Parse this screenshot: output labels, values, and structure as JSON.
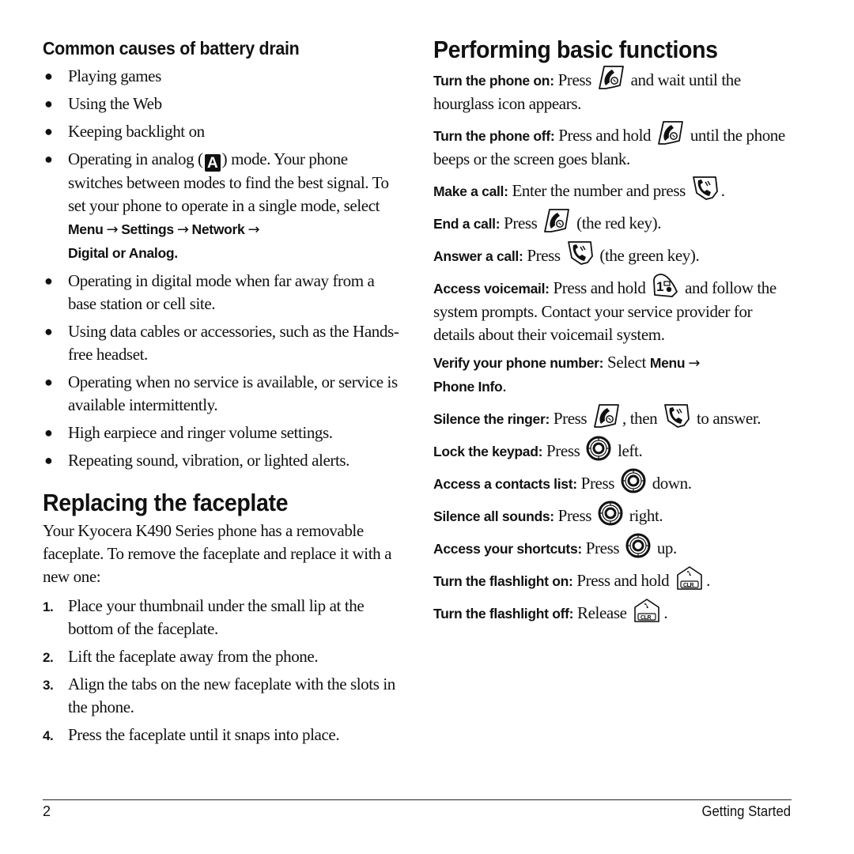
{
  "left_column": {
    "battery_section": {
      "heading": "Common causes of battery drain",
      "bullets": [
        {
          "text": "Playing games"
        },
        {
          "text": "Using the Web"
        },
        {
          "text": "Keeping backlight on"
        },
        {
          "text_before_icon": "Operating in analog (",
          "icon": "analog-mode-icon",
          "icon_glyph": "A",
          "text_after_icon": ") mode. Your phone switches between modes to find the best signal. To set your phone to operate in a single mode, select",
          "menu_path": [
            "Menu",
            "Settings",
            "Network",
            "Digital or Analog."
          ]
        },
        {
          "text": "Operating in digital mode when far away from a base station or cell site."
        },
        {
          "text": "Using data cables or accessories, such as the Hands-free headset."
        },
        {
          "text": "Operating when no service is available, or service is available intermittently."
        },
        {
          "text": "High earpiece and ringer volume settings."
        },
        {
          "text": "Repeating sound, vibration, or lighted alerts."
        }
      ]
    },
    "faceplate_section": {
      "heading": "Replacing the faceplate",
      "intro": "Your Kyocera K490 Series phone has a removable faceplate. To remove the faceplate and replace it with a new one:",
      "steps": [
        {
          "number": "1.",
          "text": "Place your thumbnail under the small lip at the bottom of the faceplate."
        },
        {
          "number": "2.",
          "text": "Lift the faceplate away from the phone."
        },
        {
          "number": "3.",
          "text": "Align the tabs on the new faceplate with the slots in the phone."
        },
        {
          "number": "4.",
          "text": "Press the faceplate until it snaps into place."
        }
      ]
    }
  },
  "right_column": {
    "heading": "Performing basic functions",
    "arrow_glyph": "→",
    "entries": [
      {
        "label": "Turn the phone on:",
        "before": " Press ",
        "icon": "end-power-key-icon",
        "after": " and wait until the hourglass icon appears."
      },
      {
        "label": "Turn the phone off:",
        "before": " Press and hold ",
        "icon": "end-power-key-icon",
        "after": " until the phone beeps or the screen goes blank."
      },
      {
        "label": "Make a call:",
        "before": " Enter the number and press ",
        "icon": "send-key-icon",
        "after": "."
      },
      {
        "label": "End a call:",
        "before": " Press ",
        "icon": "end-power-key-icon",
        "after": " (the red key)."
      },
      {
        "label": "Answer a call:",
        "before": " Press ",
        "icon": "send-key-icon",
        "after": " (the green key)."
      },
      {
        "label": "Access voicemail:",
        "before": " Press and hold ",
        "icon": "voicemail-1-key-icon",
        "after": " and follow the system prompts. Contact your service provider for details about their voicemail system."
      },
      {
        "label": "Verify your phone number:",
        "before": " Select ",
        "menu_path": [
          "Menu",
          "Phone Info"
        ],
        "after": "."
      },
      {
        "label": "Silence the ringer:",
        "before": " Press ",
        "icon": "end-power-key-icon",
        "middle": ", then ",
        "icon2": "send-key-icon",
        "after": " to answer."
      },
      {
        "label": "Lock the keypad:",
        "before": " Press ",
        "icon": "navigation-key-icon",
        "after": " left."
      },
      {
        "label": "Access a contacts list:",
        "before": " Press ",
        "icon": "navigation-key-icon",
        "after": " down."
      },
      {
        "label": "Silence all sounds:",
        "before": " Press ",
        "icon": "navigation-key-icon",
        "after": " right."
      },
      {
        "label": "Access your shortcuts:",
        "before": " Press ",
        "icon": "navigation-key-icon",
        "after": " up."
      },
      {
        "label": "Turn the flashlight on:",
        "before": " Press and hold ",
        "icon": "clear-key-icon",
        "icon_text": "CLR",
        "after": "."
      },
      {
        "label": "Turn the flashlight off:",
        "before": " Release ",
        "icon": "clear-key-icon",
        "icon_text": "CLR",
        "after": "."
      }
    ]
  },
  "footer": {
    "page_number": "2",
    "section_title": "Getting Started"
  }
}
